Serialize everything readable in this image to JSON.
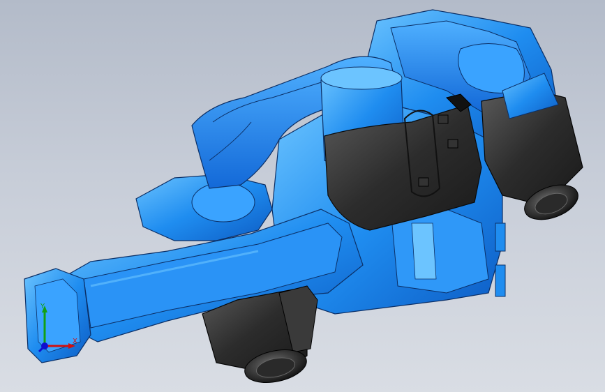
{
  "viewport": {
    "background_top": "#b3bbc9",
    "background_bottom": "#d9dde4"
  },
  "model": {
    "body_color": "#1f8df0",
    "body_highlight": "#6cc4ff",
    "edge_color": "#0b2f66",
    "motor_color": "#2c2c2c",
    "motor_highlight": "#5a5a5a"
  },
  "triad": {
    "x_label": "X",
    "y_label": "Y",
    "x_color": "#d01010",
    "y_color": "#13a013",
    "z_color": "#1010d0"
  }
}
